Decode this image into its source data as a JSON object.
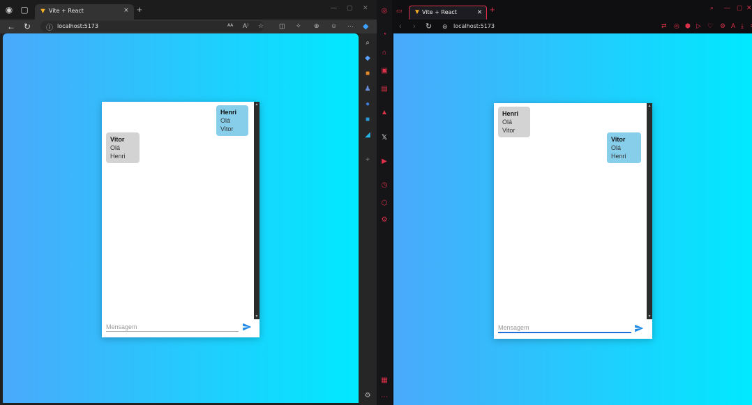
{
  "edge": {
    "tab_title": "Vite + React",
    "url": "localhost:5173",
    "toolbar_icons": [
      "reader-icon",
      "read-aloud-icon",
      "favorite-icon",
      "split-screen-icon",
      "extensions-icon",
      "collections-icon",
      "copilot-icon",
      "more-icon"
    ],
    "chat": {
      "messages": [
        {
          "sender": "Henri",
          "text": "Olá Vitor",
          "side": "right"
        },
        {
          "sender": "Vitor",
          "text": "Olá Henri",
          "side": "left"
        }
      ],
      "input_placeholder": "Mensagem"
    }
  },
  "firefox": {
    "tab_title": "Vite + React",
    "url": "localhost:5173",
    "chat": {
      "messages": [
        {
          "sender": "Henri",
          "text": "Olá Vitor",
          "side": "left"
        },
        {
          "sender": "Vitor",
          "text": "Olá Henri",
          "side": "right"
        }
      ],
      "input_placeholder": "Mensagem"
    }
  },
  "colors": {
    "gradient_start": "#4aa9fb",
    "gradient_end": "#00e9ff",
    "own_bubble": "#87ceeb",
    "other_bubble": "#d3d3d3",
    "send_icon": "#1e88e5",
    "accent_red": "#e0314a"
  }
}
